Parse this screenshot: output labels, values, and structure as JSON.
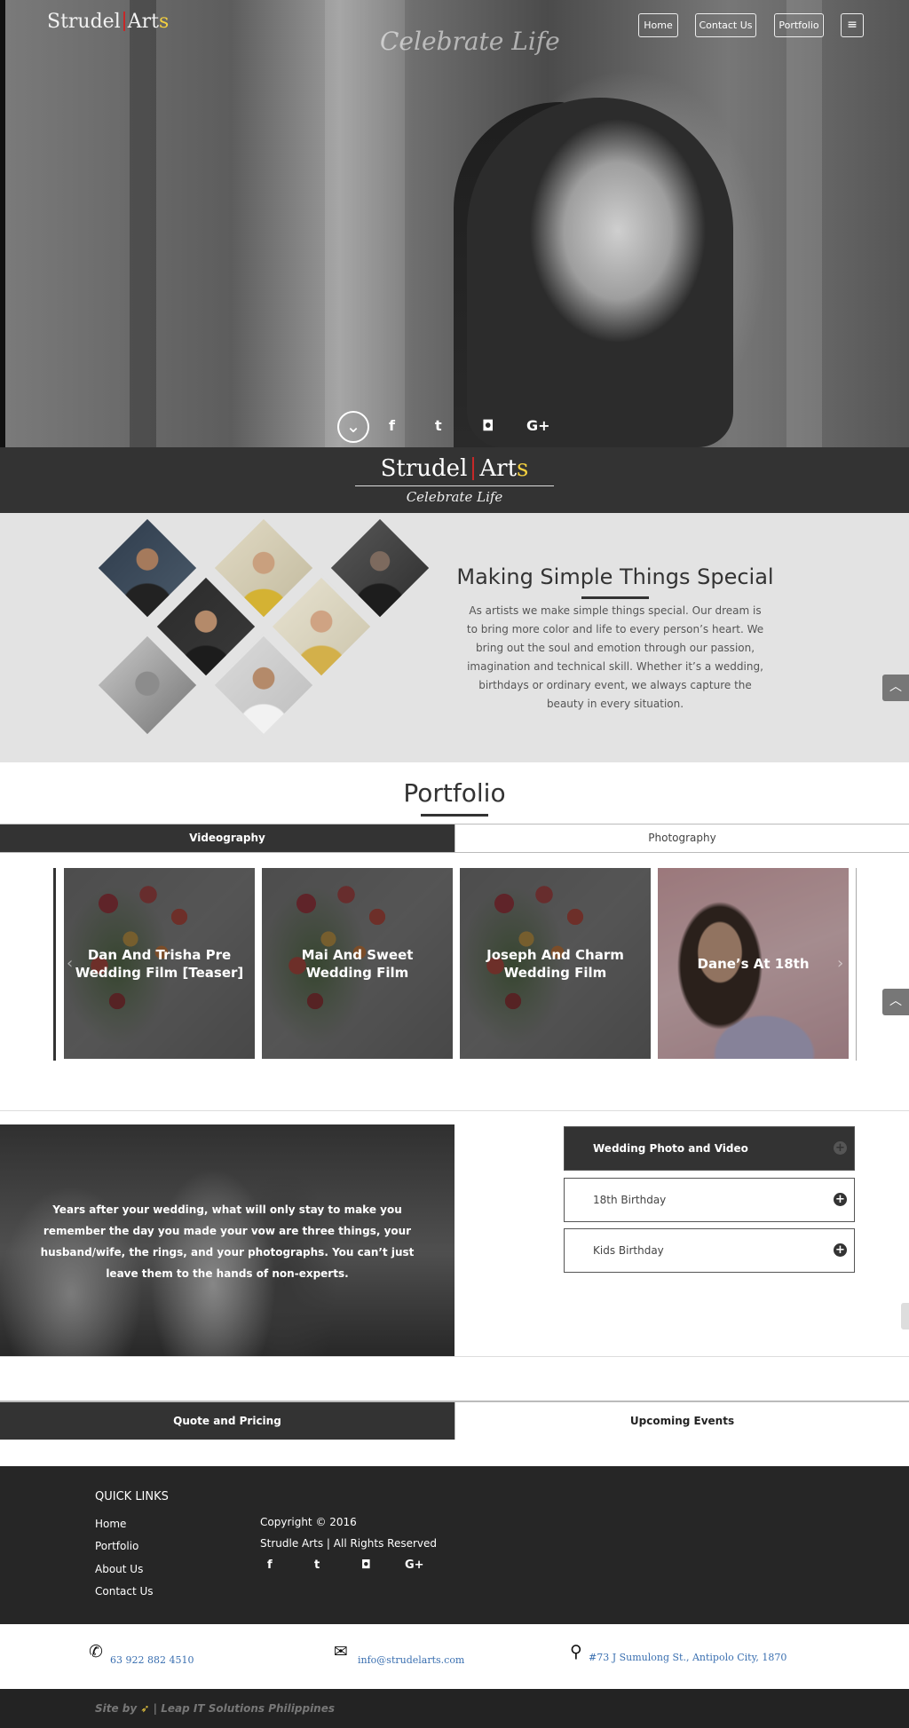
{
  "header": {
    "logo": {
      "word1": "Strudel",
      "word2": "Art",
      "word2_accent": "s"
    },
    "tagline": "Celebrate Life",
    "nav": [
      "Home",
      "Contact Us",
      "Portfolio"
    ],
    "menu_icon": "hamburger-icon"
  },
  "hero": {
    "scroll_icon": "chevron-down-icon",
    "social": [
      {
        "icon": "facebook-icon",
        "glyph": "f"
      },
      {
        "icon": "twitter-icon",
        "glyph": "t"
      },
      {
        "icon": "instagram-icon",
        "glyph": "◘"
      },
      {
        "icon": "google-plus-icon",
        "glyph": "G+"
      }
    ]
  },
  "band": {
    "logo": {
      "word1": "Strudel",
      "word2": "Art",
      "word2_accent": "s"
    },
    "tagline": "Celebrate Life"
  },
  "about": {
    "title": "Making Simple Things Special",
    "text": "As artists we make simple things special. Our dream is to bring more color and life to every person’s heart. We bring out the soul and emotion through our passion, imagination and technical skill. Whether it’s a wedding, birthdays or ordinary event, we always capture the beauty in every situation."
  },
  "portfolio": {
    "title": "Portfolio",
    "tabs": [
      "Videography",
      "Photography"
    ],
    "active_tab": "Videography",
    "items": [
      {
        "title": "Dan And Trisha Pre Wedding Film [Teaser]",
        "image": "flowers"
      },
      {
        "title": "Mai And Sweet Wedding Film",
        "image": "flowers"
      },
      {
        "title": "Joseph And Charm Wedding Film",
        "image": "flowers"
      },
      {
        "title": "Dane’s At 18th",
        "image": "girl"
      }
    ]
  },
  "services": {
    "quote": "Years after your wedding, what will only stay to make you remember the day you made your vow are three things, your husband/wife, the rings, and your photographs. You can’t just leave them to the hands of non-experts.",
    "accordion": [
      {
        "label": "Wedding Photo and Video",
        "active": true
      },
      {
        "label": "18th Birthday",
        "active": false
      },
      {
        "label": "Kids Birthday",
        "active": false
      }
    ]
  },
  "tabs2": [
    "Quote and Pricing",
    "Upcoming Events"
  ],
  "footer": {
    "quick_links_title": "QUICK LINKS",
    "links": [
      "Home",
      "Portfolio",
      "About Us",
      "Contact Us"
    ],
    "copyright": "Copyright © 2016",
    "rights": "Strudle Arts | All Rights Reserved",
    "social": [
      {
        "icon": "facebook-icon",
        "glyph": "f"
      },
      {
        "icon": "twitter-icon",
        "glyph": "t"
      },
      {
        "icon": "instagram-icon",
        "glyph": "◘"
      },
      {
        "icon": "google-plus-icon",
        "glyph": "G+"
      }
    ]
  },
  "contact": {
    "phone": "63 922 882 4510",
    "email": "info@strudelarts.com",
    "address": "#73 J Sumulong St., Antipolo City, 1870"
  },
  "credits": {
    "prefix": "Site by",
    "suffix": "| Leap IT Solutions Philippines"
  },
  "colors": {
    "dark": "#333333",
    "accent_red": "#c62828",
    "accent_yellow": "#f4d03f",
    "link_blue": "#3a6fb0"
  }
}
